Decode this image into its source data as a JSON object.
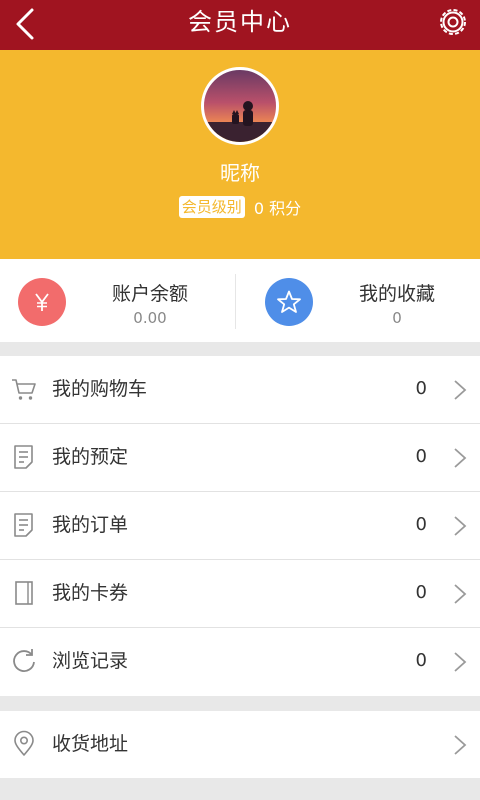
{
  "header": {
    "title": "会员中心",
    "back_icon": "chevron-left-icon",
    "settings_icon": "gear-icon",
    "background_color": "#a01420"
  },
  "profile": {
    "background_color": "#f4b82e",
    "nickname": "昵称",
    "level_badge": "会员级别",
    "points": "0 积分"
  },
  "stats": {
    "balance": {
      "icon": "yen-icon",
      "label": "账户余额",
      "value": "0.00",
      "color": "#f26c6c"
    },
    "favorites": {
      "icon": "star-icon",
      "label": "我的收藏",
      "value": "0",
      "color": "#4f8ee8"
    }
  },
  "menu": {
    "items": [
      {
        "icon": "cart-icon",
        "label": "我的购物车",
        "count": "0"
      },
      {
        "icon": "document-icon",
        "label": "我的预定",
        "count": "0"
      },
      {
        "icon": "document-icon",
        "label": "我的订单",
        "count": "0"
      },
      {
        "icon": "card-icon",
        "label": "我的卡券",
        "count": "0"
      },
      {
        "icon": "refresh-icon",
        "label": "浏览记录",
        "count": "0"
      }
    ]
  },
  "address": {
    "icon": "location-pin-icon",
    "label": "收货地址"
  }
}
